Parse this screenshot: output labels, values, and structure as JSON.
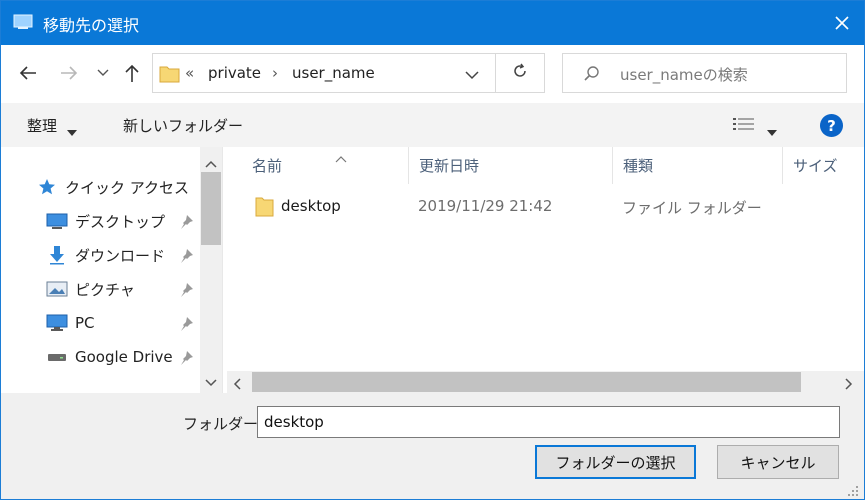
{
  "window": {
    "title": "移動先の選択",
    "accent": "#0a78d7"
  },
  "address": {
    "overflow": "«",
    "crumbs": [
      "private",
      "user_name"
    ]
  },
  "search": {
    "placeholder": "user_nameの検索"
  },
  "commands": {
    "organize": "整理",
    "new_folder": "新しいフォルダー"
  },
  "nav": {
    "items": [
      {
        "label": "クイック アクセス",
        "icon": "star-icon"
      },
      {
        "label": "デスクトップ",
        "icon": "desktop-icon",
        "pinned": true
      },
      {
        "label": "ダウンロード",
        "icon": "download-icon",
        "pinned": true
      },
      {
        "label": "ピクチャ",
        "icon": "pictures-icon",
        "pinned": true
      },
      {
        "label": "PC",
        "icon": "computer-icon",
        "pinned": true
      },
      {
        "label": "Google Drive",
        "icon": "drive-icon",
        "pinned": true
      }
    ]
  },
  "columns": [
    "名前",
    "更新日時",
    "種類",
    "サイズ"
  ],
  "files": [
    {
      "name": "desktop",
      "modified": "2019/11/29 21:42",
      "type": "ファイル フォルダー",
      "icon": "folder-icon"
    }
  ],
  "footer": {
    "folder_label": "フォルダー:",
    "folder_value": "desktop",
    "select_button": "フォルダーの選択",
    "cancel_button": "キャンセル"
  }
}
